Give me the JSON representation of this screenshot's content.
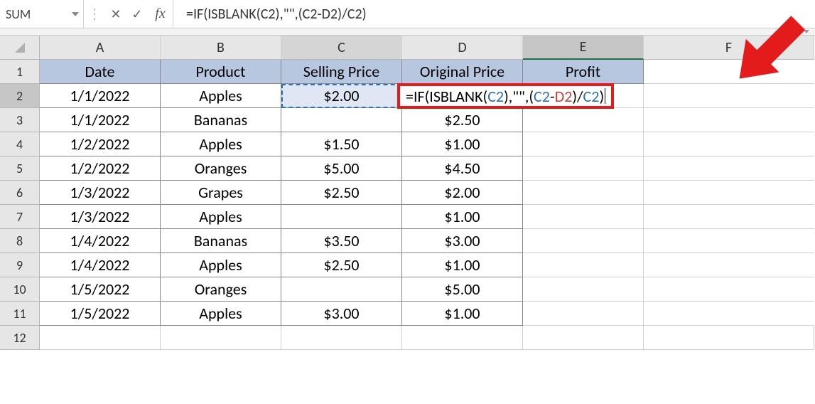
{
  "name_box": "SUM",
  "formula_bar_value": "=IF(ISBLANK(C2),\"\",(C2-D2)/C2)",
  "inline_formula_tokens": [
    {
      "t": "=IF(ISBLANK(",
      "c": "black"
    },
    {
      "t": "C2",
      "c": "blue"
    },
    {
      "t": "),\"\",",
      "c": "black"
    },
    {
      "t": "(",
      "c": "black"
    },
    {
      "t": "C2",
      "c": "blue"
    },
    {
      "t": "-",
      "c": "black"
    },
    {
      "t": "D2",
      "c": "red"
    },
    {
      "t": ")",
      "c": "black"
    },
    {
      "t": "/",
      "c": "black"
    },
    {
      "t": "C2",
      "c": "blue"
    },
    {
      "t": ")",
      "c": "black"
    }
  ],
  "icons": {
    "cancel": "✕",
    "enter": "✓",
    "fx": "fx",
    "vsep": "⋮"
  },
  "columns": [
    "A",
    "B",
    "C",
    "D",
    "E",
    "F"
  ],
  "header_row": {
    "A": "Date",
    "B": "Product",
    "C": "Selling Price",
    "D": "Original Price",
    "E": "Profit"
  },
  "rows": [
    {
      "n": "1",
      "A": "Date",
      "B": "Product",
      "C": "Selling Price",
      "D": "Original Price",
      "E": "Profit",
      "header": true
    },
    {
      "n": "2",
      "A": "1/1/2022",
      "B": "Apples",
      "C": "$2.00",
      "D": "",
      "E": ""
    },
    {
      "n": "3",
      "A": "1/1/2022",
      "B": "Bananas",
      "C": "",
      "D": "$2.50",
      "E": ""
    },
    {
      "n": "4",
      "A": "1/2/2022",
      "B": "Apples",
      "C": "$1.50",
      "D": "$1.00",
      "E": ""
    },
    {
      "n": "5",
      "A": "1/2/2022",
      "B": "Oranges",
      "C": "$5.00",
      "D": "$4.50",
      "E": ""
    },
    {
      "n": "6",
      "A": "1/3/2022",
      "B": "Grapes",
      "C": "$2.50",
      "D": "$2.00",
      "E": ""
    },
    {
      "n": "7",
      "A": "1/3/2022",
      "B": "Apples",
      "C": "",
      "D": "$1.00",
      "E": ""
    },
    {
      "n": "8",
      "A": "1/4/2022",
      "B": "Bananas",
      "C": "$3.50",
      "D": "$3.00",
      "E": ""
    },
    {
      "n": "9",
      "A": "1/4/2022",
      "B": "Apples",
      "C": "$2.50",
      "D": "$1.00",
      "E": ""
    },
    {
      "n": "10",
      "A": "1/5/2022",
      "B": "Oranges",
      "C": "",
      "D": "$5.00",
      "E": ""
    },
    {
      "n": "11",
      "A": "1/5/2022",
      "B": "Apples",
      "C": "$3.00",
      "D": "$1.00",
      "E": ""
    },
    {
      "n": "12",
      "A": "",
      "B": "",
      "C": "",
      "D": "",
      "E": ""
    }
  ],
  "annotation_color": "#e31b1b",
  "active_cell": "E2",
  "referenced_cells": {
    "C2": "blue",
    "D2": "red"
  }
}
